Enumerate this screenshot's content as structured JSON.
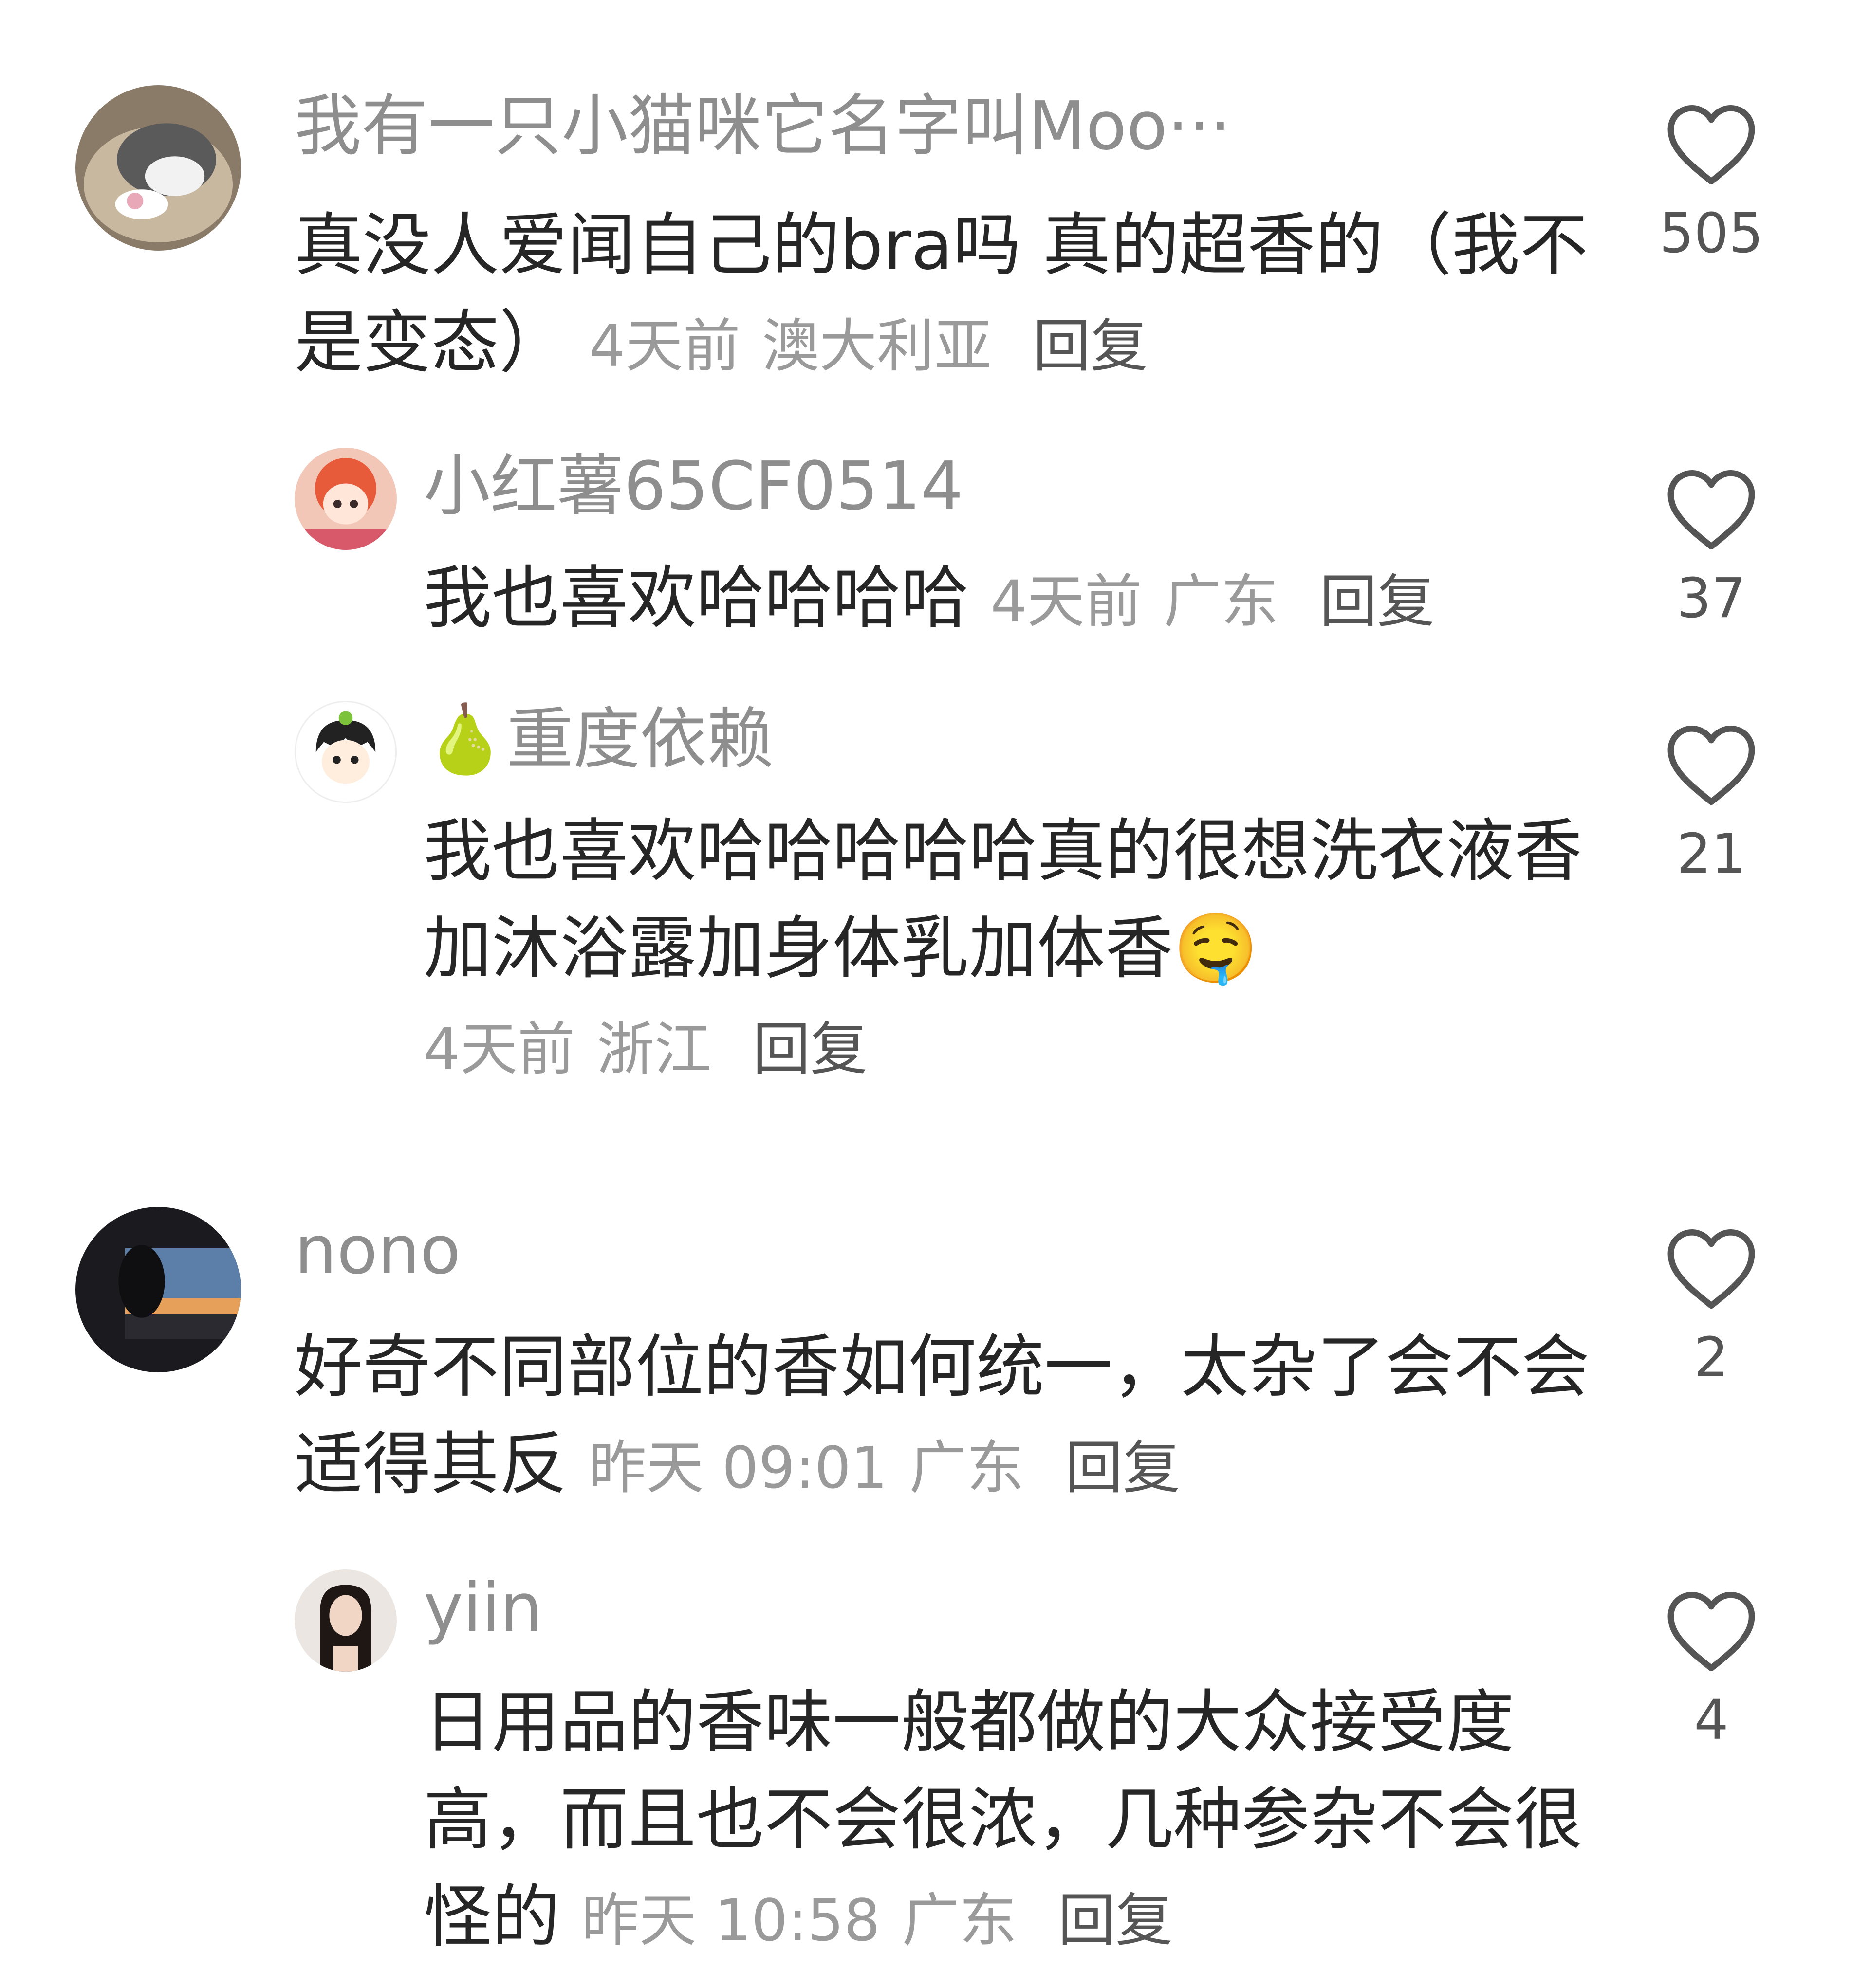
{
  "comments": [
    {
      "username": "我有一只小猫咪它名字叫Moo···",
      "text": "真没人爱闻自己的bra吗 真的超香的（我不是变态）",
      "time": "4天前",
      "location": "澳大利亚",
      "reply": "回复",
      "likes": "505",
      "avatar": "cat-photo"
    },
    {
      "username": "小红薯65CF0514",
      "text": "我也喜欢哈哈哈哈",
      "time": "4天前",
      "location": "广东",
      "reply": "回复",
      "likes": "37",
      "avatar": "cartoon-girl"
    },
    {
      "username": "🍐重度依赖",
      "text": "我也喜欢哈哈哈哈哈真的很想洗衣液香加沐浴露加身体乳加体香🤤",
      "time": "4天前",
      "location": "浙江",
      "reply": "回复",
      "likes": "21",
      "avatar": "cartoon-boy"
    },
    {
      "username": "nono",
      "text": "好奇不同部位的香如何统一，太杂了会不会适得其反",
      "time": "昨天 09:01",
      "location": "广东",
      "reply": "回复",
      "likes": "2",
      "avatar": "sunset-silhouette"
    },
    {
      "username": "yiin",
      "text": "日用品的香味一般都做的大众接受度高，而且也不会很浓，几种参杂不会很怪的",
      "time": "昨天 10:58",
      "location": "广东",
      "reply": "回复",
      "likes": "4",
      "avatar": "woman-photo"
    }
  ],
  "icons": {
    "like": "heart-outline-icon"
  }
}
